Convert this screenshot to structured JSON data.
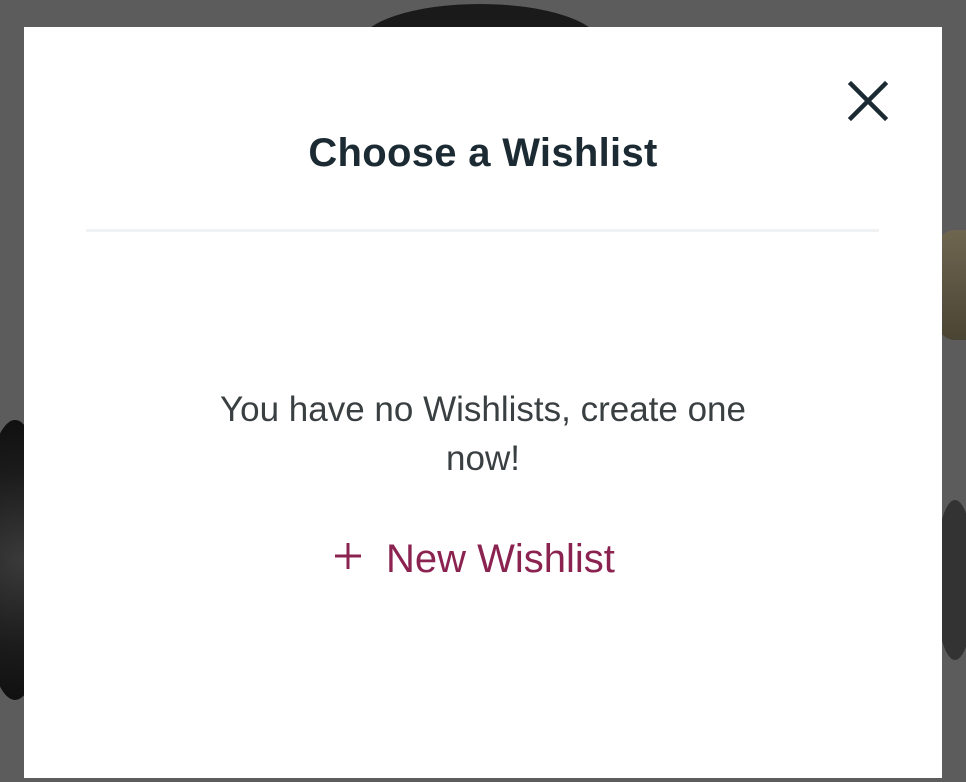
{
  "modal": {
    "title": "Choose a Wishlist",
    "close_icon": "close-icon",
    "empty_message": "You have no Wishlists, create one now!",
    "new_wishlist": {
      "icon": "plus-icon",
      "label": "New Wishlist"
    }
  },
  "colors": {
    "title": "#1c2b33",
    "body_text": "#3a3f42",
    "accent": "#8b2350",
    "backdrop": "#5c5c5c",
    "modal_bg": "#ffffff"
  }
}
